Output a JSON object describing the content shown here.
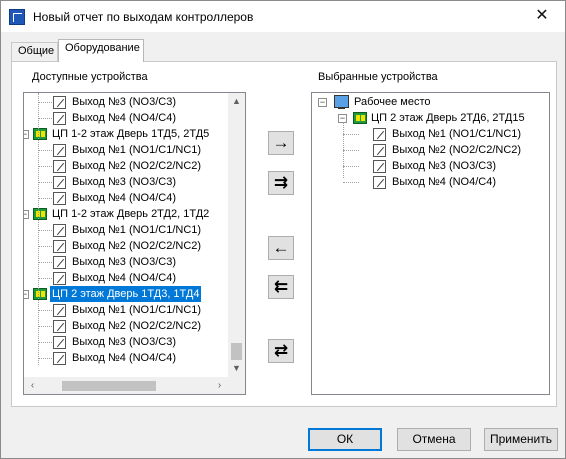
{
  "window": {
    "title": "Новый отчет по выходам контроллеров"
  },
  "tabs": [
    {
      "label": "Общие",
      "active": false
    },
    {
      "label": "Оборудование",
      "active": true
    }
  ],
  "available": {
    "label": "Доступные устройства",
    "rows": [
      {
        "kind": "output",
        "label": "Выход №3 (NO3/C3)"
      },
      {
        "kind": "output",
        "label": "Выход №4 (NO4/C4)"
      },
      {
        "kind": "device",
        "label": "ЦП 1-2 этаж Дверь 1ТД5, 2ТД5"
      },
      {
        "kind": "output",
        "label": "Выход №1 (NO1/C1/NC1)"
      },
      {
        "kind": "output",
        "label": "Выход №2 (NO2/C2/NC2)"
      },
      {
        "kind": "output",
        "label": "Выход №3 (NO3/C3)"
      },
      {
        "kind": "output",
        "label": "Выход №4 (NO4/C4)"
      },
      {
        "kind": "device",
        "label": "ЦП 1-2 этаж Дверь 2ТД2, 1ТД2"
      },
      {
        "kind": "output",
        "label": "Выход №1 (NO1/C1/NC1)"
      },
      {
        "kind": "output",
        "label": "Выход №2 (NO2/C2/NC2)"
      },
      {
        "kind": "output",
        "label": "Выход №3 (NO3/C3)"
      },
      {
        "kind": "output",
        "label": "Выход №4 (NO4/C4)"
      },
      {
        "kind": "device",
        "label": "ЦП 2 этаж Дверь 1ТД3, 1ТД4",
        "selected": true
      },
      {
        "kind": "output",
        "label": "Выход №1 (NO1/C1/NC1)"
      },
      {
        "kind": "output",
        "label": "Выход №2 (NO2/C2/NC2)"
      },
      {
        "kind": "output",
        "label": "Выход №3 (NO3/C3)"
      },
      {
        "kind": "output",
        "label": "Выход №4 (NO4/C4)"
      }
    ]
  },
  "selected": {
    "label": "Выбранные устройства",
    "root": "Рабочее место",
    "device": "ЦП 2 этаж Дверь 2ТД6, 2ТД15",
    "outputs": [
      "Выход №1 (NO1/C1/NC1)",
      "Выход №2 (NO2/C2/NC2)",
      "Выход №3 (NO3/C3)",
      "Выход №4 (NO4/C4)"
    ]
  },
  "transfer_buttons": {
    "add": "→",
    "add_all": "⇉",
    "remove": "←",
    "remove_all": "⇇",
    "swap": "⇄"
  },
  "footer": {
    "ok": "ОК",
    "cancel": "Отмена",
    "apply": "Применить"
  },
  "icons": {
    "output": "output-relay-icon",
    "device": "controller-icon",
    "workstation": "workstation-icon",
    "close": "close-icon"
  },
  "colors": {
    "selection": "#0078d7",
    "default_button_border": "#0078d7"
  }
}
